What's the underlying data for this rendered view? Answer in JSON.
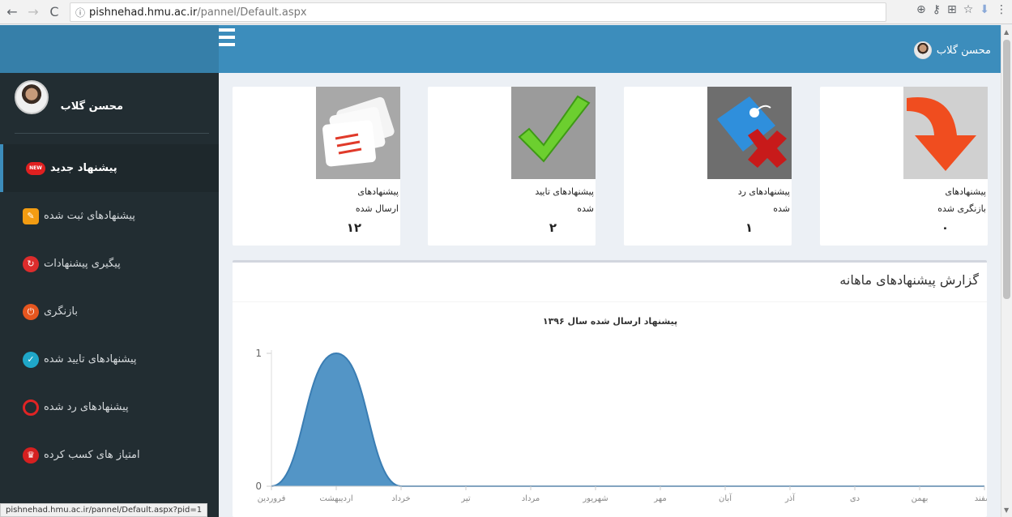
{
  "browser": {
    "url_host": "pishnehad.hmu.ac.ir",
    "url_path": "/pannel/Default.aspx",
    "status_url": "pishnehad.hmu.ac.ir/pannel/Default.aspx?pid=1"
  },
  "header": {
    "user_name": "محسن گلاب"
  },
  "sidebar": {
    "user_name": "محسن گلاب",
    "items": [
      {
        "label": "پیشنهاد جدید",
        "icon": "new-badge-icon",
        "badge": "NEW"
      },
      {
        "label": "پیشنهادهای ثبت شده",
        "icon": "edit-note-icon"
      },
      {
        "label": "پیگیری پیشنهادات",
        "icon": "refresh-icon"
      },
      {
        "label": "بازنگری",
        "icon": "power-icon"
      },
      {
        "label": "پیشنهادهای تایید شده",
        "icon": "check-circle-icon"
      },
      {
        "label": "پیشنهادهای رد شده",
        "icon": "ban-icon"
      },
      {
        "label": "امتیاز های کسب کرده",
        "icon": "trophy-icon"
      }
    ]
  },
  "stats": [
    {
      "line1": "پیشنهادهای",
      "line2": "ارسال شده",
      "value": "۱۲",
      "image": "documents-icon"
    },
    {
      "line1": "پیشنهادهای تایید",
      "line2": "شده",
      "value": "۲",
      "image": "checkmark-icon"
    },
    {
      "line1": "پیشنهادهای رد",
      "line2": "شده",
      "value": "۱",
      "image": "rejected-tag-icon"
    },
    {
      "line1": "پیشنهادهای",
      "line2": "بازنگری شده",
      "value": "۰",
      "image": "down-arrow-icon"
    }
  ],
  "report": {
    "title": "گزارش پیشنهادهای ماهانه"
  },
  "chart_data": {
    "type": "area",
    "title": "پیشنهاد ارسال شده سال ۱۳۹۶",
    "categories": [
      "فروردین",
      "اردیبهشت",
      "خرداد",
      "تیر",
      "مرداد",
      "شهریور",
      "مهر",
      "آبان",
      "آذر",
      "دی",
      "بهمن",
      "اسفند"
    ],
    "values": [
      0,
      1,
      0,
      0,
      0,
      0,
      0,
      0,
      0,
      0,
      0,
      0
    ],
    "y_ticks": [
      "0",
      "1"
    ],
    "ylim": [
      0,
      1
    ],
    "color": "#4a8fc3",
    "smooth": true
  }
}
